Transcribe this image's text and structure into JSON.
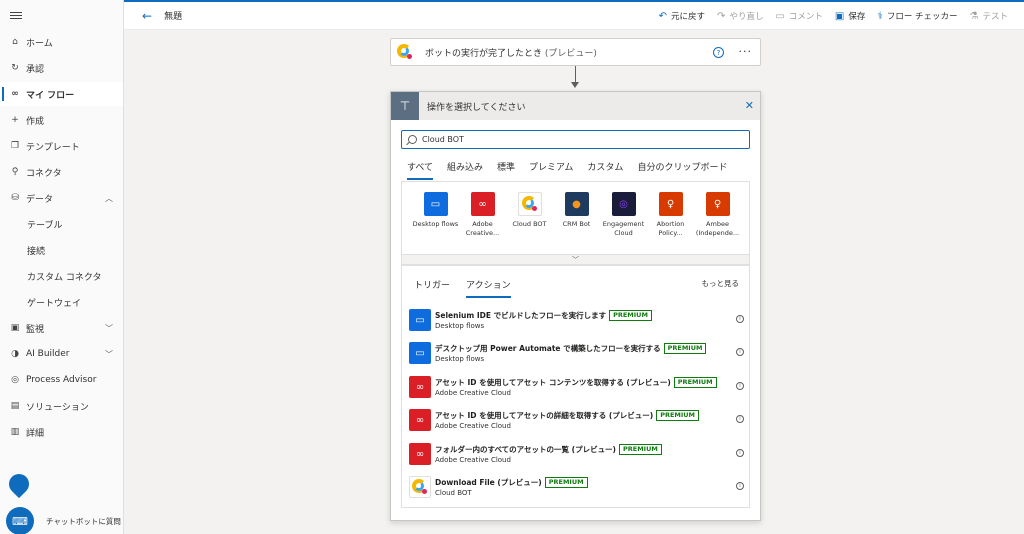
{
  "sidebar": {
    "items": [
      {
        "label": "ホーム",
        "icon": "home-icon"
      },
      {
        "label": "承認",
        "icon": "approvals-icon"
      },
      {
        "label": "マイ フロー",
        "icon": "flows-icon"
      },
      {
        "label": "作成",
        "icon": "plus-icon"
      },
      {
        "label": "テンプレート",
        "icon": "templates-icon"
      },
      {
        "label": "コネクタ",
        "icon": "connector-icon"
      },
      {
        "label": "データ",
        "icon": "data-icon"
      },
      {
        "label": "テーブル"
      },
      {
        "label": "接続"
      },
      {
        "label": "カスタム コネクタ"
      },
      {
        "label": "ゲートウェイ"
      },
      {
        "label": "監視",
        "icon": "monitor-icon"
      },
      {
        "label": "AI Builder",
        "icon": "ai-icon"
      },
      {
        "label": "Process Advisor",
        "icon": "process-icon"
      },
      {
        "label": "ソリューション",
        "icon": "solutions-icon"
      },
      {
        "label": "詳細",
        "icon": "learn-icon"
      }
    ],
    "chatbot_label": "チャットボットに質問"
  },
  "commandbar": {
    "title": "無題",
    "undo": "元に戻す",
    "redo": "やり直し",
    "comment": "コメント",
    "save": "保存",
    "checker": "フロー チェッカー",
    "test": "テスト"
  },
  "trigger": {
    "label": "ボットの実行が完了したとき",
    "preview": "(プレビュー)",
    "help": "?",
    "more": "···"
  },
  "panel": {
    "title": "操作を選択してください",
    "search_value": "Cloud BOT",
    "tabs": [
      "すべて",
      "組み込み",
      "標準",
      "プレミアム",
      "カスタム",
      "自分のクリップボード"
    ],
    "connectors": [
      {
        "label": "Desktop flows"
      },
      {
        "label": "Adobe Creative..."
      },
      {
        "label": "Cloud BOT"
      },
      {
        "label": "CRM Bot"
      },
      {
        "label": "Engagement Cloud"
      },
      {
        "label": "Abortion Policy..."
      },
      {
        "label": "Ambee (Independe..."
      }
    ],
    "subtabs": [
      "トリガー",
      "アクション"
    ],
    "see_more": "もっと見る",
    "actions": [
      {
        "name": "Selenium IDE でビルドしたフローを実行します",
        "sub": "Desktop flows",
        "badge": "PREMIUM"
      },
      {
        "name": "デスクトップ用 Power Automate で構築したフローを実行する",
        "sub": "Desktop flows",
        "badge": "PREMIUM"
      },
      {
        "name": "アセット ID を使用してアセット コンテンツを取得する (プレビュー)",
        "sub": "Adobe Creative Cloud",
        "badge": "PREMIUM"
      },
      {
        "name": "アセット ID を使用してアセットの詳細を取得する (プレビュー)",
        "sub": "Adobe Creative Cloud",
        "badge": "PREMIUM"
      },
      {
        "name": "フォルダー内のすべてのアセットの一覧 (プレビュー)",
        "sub": "Adobe Creative Cloud",
        "badge": "PREMIUM"
      },
      {
        "name": "Download File (プレビュー)",
        "sub": "Cloud BOT",
        "badge": "PREMIUM"
      }
    ]
  }
}
